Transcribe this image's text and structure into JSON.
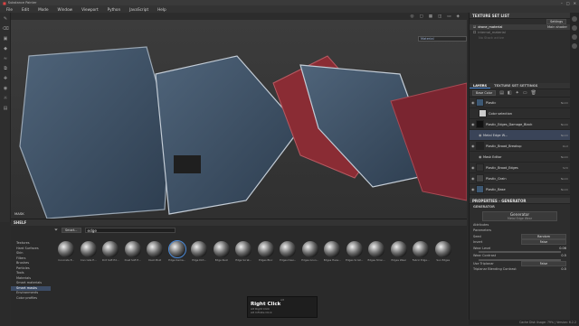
{
  "app": {
    "title": "Substance Painter"
  },
  "menu": [
    "File",
    "Edit",
    "Mode",
    "Window",
    "Viewport",
    "Python",
    "JavaScript",
    "Help"
  ],
  "viewport": {
    "mode_label": "MASK",
    "display_dropdown": "Material"
  },
  "texture_set_list": {
    "title": "TEXTURE SET LIST",
    "settings_label": "Settings",
    "items": [
      {
        "name": "drone_material",
        "shader": "Main shader"
      },
      {
        "name": "internal_material",
        "shader": ""
      }
    ],
    "sub_item": "No Stack active"
  },
  "layers_panel": {
    "tabs": [
      "LAYERS",
      "TEXTURE SET SETTINGS"
    ],
    "blend_dropdown": "Base Color",
    "layers": [
      {
        "name": "Plastic",
        "blend": "Norm",
        "opacity": "100"
      },
      {
        "name": "Color selection",
        "blend": "",
        "opacity": ""
      },
      {
        "name": "Plastic_Edges_Damage_Black",
        "blend": "Norm",
        "opacity": "100"
      },
      {
        "name": "Metal Edge W...",
        "blend": "Norm",
        "opacity": "100"
      },
      {
        "name": "Plastic_Broad_Breakup",
        "blend": "Ovrl",
        "opacity": "100"
      },
      {
        "name": "Mask Editor",
        "blend": "Norm",
        "opacity": "100"
      },
      {
        "name": "Plastic_Broad_Edges",
        "blend": "Sctr",
        "opacity": "100"
      },
      {
        "name": "Plastic_Grain",
        "blend": "Norm",
        "opacity": "100"
      },
      {
        "name": "Plastic_Base",
        "blend": "Norm",
        "opacity": "100"
      }
    ]
  },
  "properties": {
    "title": "PROPERTIES - GENERATOR",
    "section": "GENERATOR",
    "generator_label": "Generator",
    "generator_value": "Metal Edge Wear",
    "attributes": "Attributes",
    "parameters": "Parameters",
    "params": [
      {
        "label": "Seed",
        "value": "Random"
      },
      {
        "label": "Invert",
        "value": "False"
      },
      {
        "label": "Wear Level",
        "value": "0.06"
      },
      {
        "label": "Wear Contrast",
        "value": "0.5"
      },
      {
        "label": "Use Triplanar",
        "value": "False"
      },
      {
        "label": "Triplanar Blending Contrast",
        "value": "0.5"
      }
    ]
  },
  "shelf": {
    "title": "SHELF",
    "search_value": "edge",
    "filter_chip": "Smart...",
    "categories": [
      "Textures",
      "Hard Surfaces",
      "Skin",
      "Filters",
      "Brushes",
      "Particles",
      "Tools",
      "Materials",
      "Smart materials",
      "Smart masks",
      "Environments",
      "Color profiles"
    ],
    "selected_category": "Smart masks",
    "items": [
      "Concrete E...",
      "Concrete E...",
      "Dirt Soft Ed...",
      "Dust Soft E...",
      "Dust Mold",
      "Edge Dama...",
      "Edge Dirt...",
      "Edge Rust",
      "Edge Scrat...",
      "Edges Bloc",
      "Edges Desi...",
      "Edges Grun...",
      "Edges Heav...",
      "Edges Scrat...",
      "Edges Stron...",
      "Edges Wear",
      "Fabric Edge...",
      "Sun Edges"
    ],
    "selected_item": "Edge Dama..."
  },
  "tooltip": {
    "header": "Alt",
    "title": "Right Click",
    "line1": "Alt Right Click",
    "line2": "Alt Infinite Click"
  },
  "status": "Cache Disk Usage: 79% | Version: 6.2.2"
}
